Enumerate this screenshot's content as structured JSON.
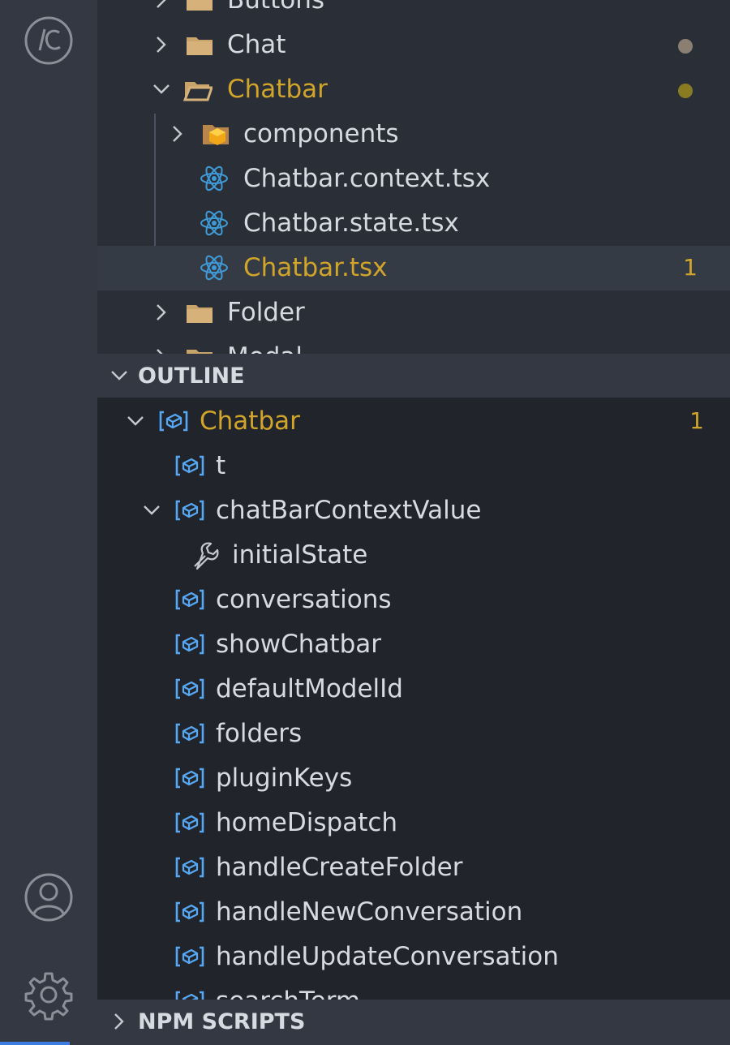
{
  "activity_bar": {
    "top_icon": "remote-explorer-icon",
    "account_icon": "account-icon",
    "settings_icon": "gear-icon"
  },
  "explorer": {
    "items": [
      {
        "label": "Buttons",
        "icon": "folder-icon"
      },
      {
        "label": "Chat",
        "icon": "folder-icon",
        "status_dot": "modified"
      },
      {
        "label": "Chatbar",
        "icon": "folder-open-icon",
        "status_dot": "modified"
      },
      {
        "label": "components",
        "icon": "components-folder-icon"
      },
      {
        "label": "Chatbar.context.tsx",
        "icon": "react-icon"
      },
      {
        "label": "Chatbar.state.tsx",
        "icon": "react-icon"
      },
      {
        "label": "Chatbar.tsx",
        "icon": "react-icon",
        "badge": "1"
      },
      {
        "label": "Folder",
        "icon": "folder-icon"
      },
      {
        "label": "Modal",
        "icon": "folder-icon"
      }
    ]
  },
  "outline": {
    "title": "OUTLINE",
    "items": [
      {
        "label": "Chatbar",
        "icon": "variable-icon",
        "badge": "1"
      },
      {
        "label": "t",
        "icon": "variable-icon"
      },
      {
        "label": "chatBarContextValue",
        "icon": "variable-icon"
      },
      {
        "label": "initialState",
        "icon": "wrench-icon"
      },
      {
        "label": "conversations",
        "icon": "variable-icon"
      },
      {
        "label": "showChatbar",
        "icon": "variable-icon"
      },
      {
        "label": "defaultModelId",
        "icon": "variable-icon"
      },
      {
        "label": "folders",
        "icon": "variable-icon"
      },
      {
        "label": "pluginKeys",
        "icon": "variable-icon"
      },
      {
        "label": "homeDispatch",
        "icon": "variable-icon"
      },
      {
        "label": "handleCreateFolder",
        "icon": "variable-icon"
      },
      {
        "label": "handleNewConversation",
        "icon": "variable-icon"
      },
      {
        "label": "handleUpdateConversation",
        "icon": "variable-icon"
      },
      {
        "label": "searchTerm",
        "icon": "variable-icon"
      }
    ]
  },
  "npm_scripts": {
    "title": "NPM SCRIPTS"
  },
  "colors": {
    "activity_bar_bg": "#333842",
    "explorer_bg": "#2a2f37",
    "outline_bg": "#21252b",
    "modified_gold": "#d1a52a",
    "folder_tan": "#c8a36a",
    "react_blue": "#3f9bd8",
    "symbol_blue": "#56a8f5",
    "accent_blue": "#3d7ce0"
  }
}
